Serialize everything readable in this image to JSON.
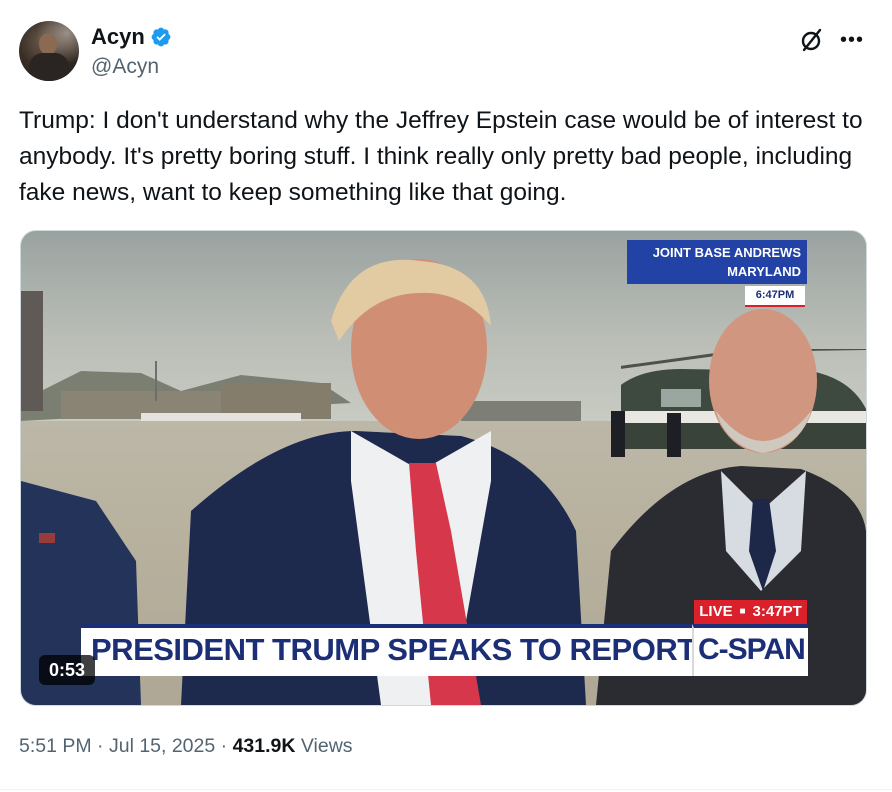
{
  "author": {
    "display_name": "Acyn",
    "handle": "@Acyn",
    "verified": true,
    "verified_color": "#1d9bf0"
  },
  "tweet": {
    "text": "Trump: I don't understand why the Jeffrey Epstein case would be of interest to anybody. It's pretty boring stuff. I think really only pretty bad people, including fake news, want to keep something like that going."
  },
  "media": {
    "type": "video",
    "duration": "0:53",
    "overlay": {
      "location_line1": "JOINT BASE ANDREWS",
      "location_line2": "MARYLAND",
      "location_time": "6:47PM",
      "live_label": "LIVE",
      "live_time": "3:47PT",
      "headline": "PRESIDENT TRUMP SPEAKS TO REPORTERS",
      "network": "C-SPAN"
    }
  },
  "meta": {
    "time": "5:51 PM",
    "separator": "·",
    "date": "Jul 15, 2025",
    "views_count": "431.9K",
    "views_label": "Views"
  },
  "icons": {
    "grok": "grok-icon",
    "more": "more-options-icon",
    "verified": "verified-badge-icon"
  }
}
